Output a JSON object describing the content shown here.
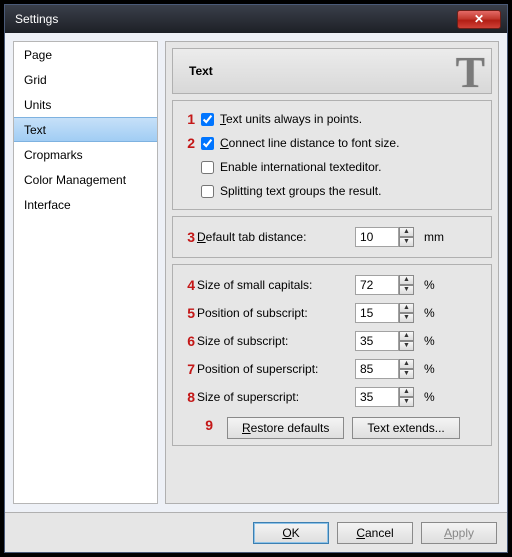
{
  "window": {
    "title": "Settings"
  },
  "nav": {
    "items": [
      {
        "label": "Page"
      },
      {
        "label": "Grid"
      },
      {
        "label": "Units"
      },
      {
        "label": "Text",
        "selected": true
      },
      {
        "label": "Cropmarks"
      },
      {
        "label": "Color Management"
      },
      {
        "label": "Interface"
      }
    ]
  },
  "section": {
    "title": "Text",
    "icon": "T"
  },
  "markers": {
    "m1": "1",
    "m2": "2",
    "m3": "3",
    "m4": "4",
    "m5": "5",
    "m6": "6",
    "m7": "7",
    "m8": "8",
    "m9": "9"
  },
  "checks": {
    "units_points": {
      "label": "Text units always in points.",
      "u": "T",
      "rest": "ext units always in points.",
      "checked": true
    },
    "connect_line": {
      "label": "Connect line distance to font size.",
      "u": "C",
      "rest": "onnect line distance to font size.",
      "checked": true
    },
    "intl_editor": {
      "label": "Enable international texteditor.",
      "checked": false
    },
    "split_groups": {
      "label": "Splitting text groups the result.",
      "checked": false
    }
  },
  "tab": {
    "label_u": "D",
    "label_rest": "efault tab distance:",
    "value": "10",
    "unit": "mm"
  },
  "fields": {
    "small_caps": {
      "label": "Size of small capitals:",
      "value": "72",
      "unit": "%"
    },
    "sub_pos": {
      "label": "Position of subscript:",
      "value": "15",
      "unit": "%"
    },
    "sub_size": {
      "label": "Size of subscript:",
      "value": "35",
      "unit": "%"
    },
    "sup_pos": {
      "label": "Position of superscript:",
      "value": "85",
      "unit": "%"
    },
    "sup_size": {
      "label": "Size of superscript:",
      "value": "35",
      "unit": "%"
    }
  },
  "buttons": {
    "restore_u": "R",
    "restore_rest": "estore defaults",
    "extends": "Text extends..."
  },
  "footer": {
    "ok_u": "O",
    "ok_rest": "K",
    "cancel_u": "C",
    "cancel_rest": "ancel",
    "apply_u": "A",
    "apply_rest": "pply"
  }
}
